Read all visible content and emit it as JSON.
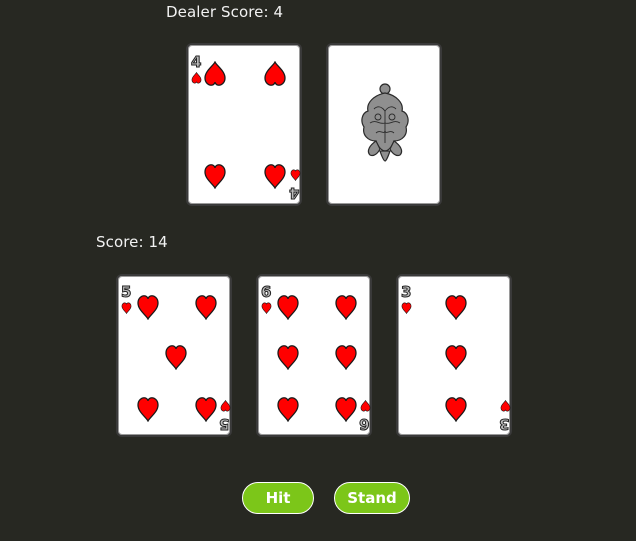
{
  "dealer": {
    "score_label": "Dealer Score: 4",
    "cards": [
      {
        "rank": "4",
        "suit": "heart",
        "face_up": true
      },
      {
        "rank": "",
        "suit": "",
        "face_up": false
      }
    ]
  },
  "player": {
    "score_label": "Score: 14",
    "cards": [
      {
        "rank": "5",
        "suit": "heart",
        "face_up": true
      },
      {
        "rank": "6",
        "suit": "heart",
        "face_up": true
      },
      {
        "rank": "3",
        "suit": "heart",
        "face_up": true
      }
    ]
  },
  "actions": {
    "hit_label": "Hit",
    "stand_label": "Stand"
  },
  "colors": {
    "background": "#272822",
    "suit": "#ff0000",
    "button": "#7cc619"
  },
  "icons": {
    "pip": "heart-pip-icon",
    "card_back": "card-back-emblem-icon"
  }
}
